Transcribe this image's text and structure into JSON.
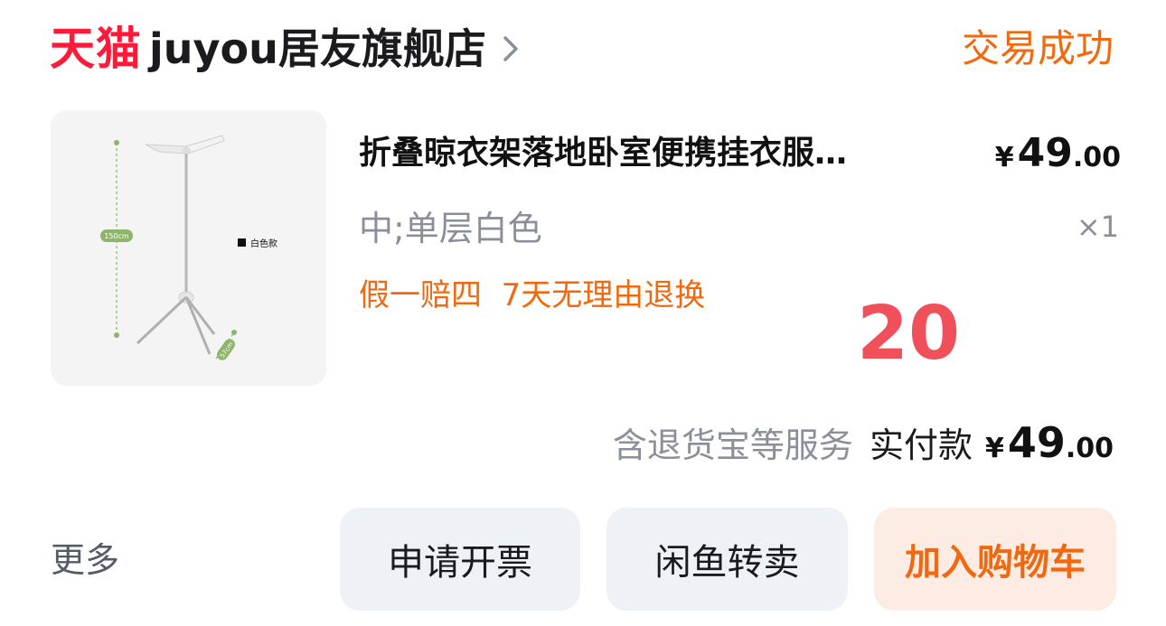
{
  "header": {
    "platform_logo": "天猫",
    "store_name": "juyou居友旗舰店",
    "order_status": "交易成功",
    "accent_color": "#ff1a3a",
    "status_color": "#f2680e"
  },
  "product": {
    "title": "折叠晾衣架落地卧室便携挂衣服…",
    "price_symbol": "¥",
    "price_int": "49",
    "price_dec": ".00",
    "spec": "中;单层白色",
    "quantity": "×1",
    "service_tags": "假一赔四  7天无理由退换",
    "overlay_number": "20",
    "image": {
      "height_label": "150cm",
      "leg_label": "57cm",
      "variant_label": "白色款"
    }
  },
  "payment": {
    "note": "含退货宝等服务",
    "label": "实付款",
    "symbol": "¥",
    "amount_int": "49",
    "amount_dec": ".00"
  },
  "actions": {
    "more": "更多",
    "invoice": "申请开票",
    "resell": "闲鱼转卖",
    "add_to_cart": "加入购物车"
  },
  "icons": {
    "store_chevron": "chevron-right-icon"
  }
}
